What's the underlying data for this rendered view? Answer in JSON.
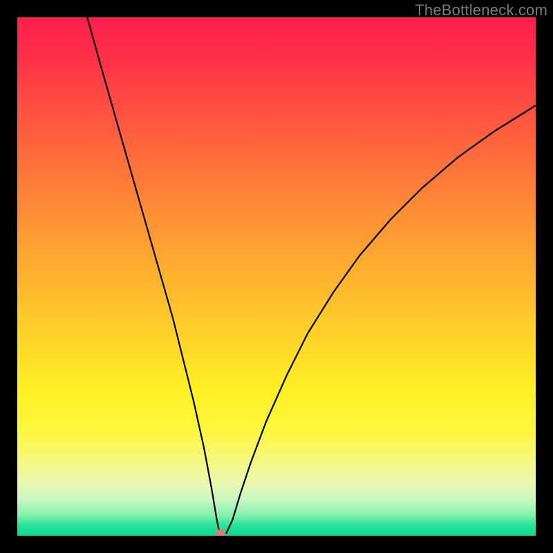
{
  "watermark": "TheBottleneck.com",
  "marker": {
    "x_pct": 39.2,
    "y_pct": 99.4
  },
  "chart_data": {
    "type": "line",
    "title": "",
    "xlabel": "",
    "ylabel": "",
    "xlim": [
      0,
      100
    ],
    "ylim": [
      0,
      100
    ],
    "grid": false,
    "legend": false,
    "annotations": [
      "TheBottleneck.com"
    ],
    "background_gradient": {
      "top_color": "#ff1f4d",
      "mid_color": "#ffd428",
      "bottom_color": "#07da8f"
    },
    "series": [
      {
        "name": "left_branch",
        "x": [
          13.5,
          16,
          18,
          20,
          22,
          24,
          26,
          28,
          30,
          32,
          34,
          36,
          37.5,
          38.5,
          39
        ],
        "values": [
          100,
          91,
          84,
          77,
          70,
          63,
          56,
          49,
          42,
          34,
          26,
          17,
          9,
          3,
          0.5
        ]
      },
      {
        "name": "right_branch",
        "x": [
          40.3,
          41.5,
          43,
          45,
          48,
          52,
          56,
          61,
          66,
          72,
          78,
          85,
          92,
          100
        ],
        "values": [
          0.5,
          3,
          8,
          14,
          22,
          31,
          39,
          47,
          54,
          61,
          67,
          73,
          78,
          83
        ]
      }
    ],
    "marker_point": {
      "x": 39.5,
      "y": 0.6
    }
  }
}
